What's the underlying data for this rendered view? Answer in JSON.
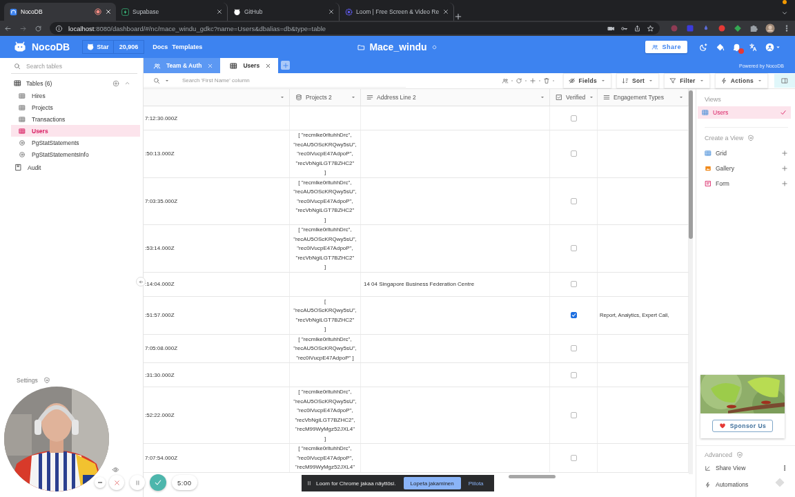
{
  "browser": {
    "tabs": [
      {
        "title": "NocoDB",
        "kind": "nocodb",
        "selected": true,
        "recording": true
      },
      {
        "title": "Supabase",
        "kind": "supabase",
        "selected": false,
        "recording": false
      },
      {
        "title": "GitHub",
        "kind": "github",
        "selected": false,
        "recording": false
      },
      {
        "title": "Loom | Free Screen & Video Re",
        "kind": "loom",
        "selected": false,
        "recording": false
      }
    ],
    "url_host": "localhost",
    "url_rest": ":8080/dashboard/#/nc/mace_windu_gdkc?name=Users&dbalias=db&type=table"
  },
  "header": {
    "brand": "NocoDB",
    "star_label": "Star",
    "star_count": "20,906",
    "links": [
      "Docs",
      "Templates"
    ],
    "project": "Mace_windu",
    "share": "Share",
    "has_notifications": true,
    "powered_by": "Powered by NocoDB"
  },
  "sidebar": {
    "search_placeholder": "Search tables",
    "group": "Tables (6)",
    "items": [
      {
        "label": "Hires",
        "kind": "table",
        "selected": false
      },
      {
        "label": "Projects",
        "kind": "table",
        "selected": false
      },
      {
        "label": "Transactions",
        "kind": "table",
        "selected": false
      },
      {
        "label": "Users",
        "kind": "table",
        "selected": true
      },
      {
        "label": "PgStatStatements",
        "kind": "view",
        "selected": false
      },
      {
        "label": "PgStatStatementsInfo",
        "kind": "view",
        "selected": false
      }
    ],
    "audit": "Audit",
    "settings": "Settings"
  },
  "tabs": [
    {
      "label": "Team & Auth",
      "kind": "team",
      "selected": false
    },
    {
      "label": "Users",
      "kind": "table",
      "selected": true
    }
  ],
  "toolbar": {
    "search_placeholder": "Search 'First Name' column",
    "menus": [
      {
        "label": "Fields",
        "kind": "fields"
      },
      {
        "label": "Sort",
        "kind": "sort"
      },
      {
        "label": "Filter",
        "kind": "filter"
      },
      {
        "label": "Actions",
        "kind": "actions"
      }
    ]
  },
  "table": {
    "columns": [
      {
        "title": "Projects 2",
        "kind": "links"
      },
      {
        "title": "Address Line 2",
        "kind": "text"
      },
      {
        "title": "Verified",
        "kind": "checkbox"
      },
      {
        "title": "Engagement Types",
        "kind": "multiselect"
      }
    ],
    "rows": [
      {
        "column_1": "7:12:30.000Z",
        "verified": false
      },
      {
        "column_1": ":50:13.000Z",
        "projects": [
          "[ \"recmlke0rltuhhDrc\",",
          "\"recAU5OScKRQwy5sU\",",
          "\"rec0iVucpE47AdpoP\",",
          "\"recVbNgiLGT7BZHC2\"",
          "]"
        ],
        "verified": false
      },
      {
        "column_1": "7:03:35.000Z",
        "projects": [
          "[ \"recmlke0rltuhhDrc\",",
          "\"recAU5OScKRQwy5sU\",",
          "\"rec0iVucpE47AdpoP\",",
          "\"recVbNgiLGT7BZHC2\"",
          "]"
        ],
        "verified": false
      },
      {
        "column_1": ":53:14.000Z",
        "projects": [
          "[ \"recmlke0rltuhhDrc\",",
          "\"recAU5OScKRQwy5sU\",",
          "\"rec0iVucpE47AdpoP\",",
          "\"recVbNgiLGT7BZHC2\"",
          "]"
        ],
        "verified": false
      },
      {
        "column_1": ":14:04.000Z",
        "address": "14 04 Singapore Business Federation Centre",
        "verified": false
      },
      {
        "column_1": ":51:57.000Z",
        "projects": [
          "[",
          "\"recAU5OScKRQwy5sU\",",
          "\"recVbNgiLGT7BZHC2\"",
          "]"
        ],
        "verified": true,
        "engagement": "Report, Analytics, Expert Call,"
      },
      {
        "column_1": "7:05:08.000Z",
        "projects": [
          "[ \"recmlke0rltuhhDrc\",",
          "\"recAU5OScKRQwy5sU\",",
          "\"rec0iVucpE47AdpoP\" ]"
        ],
        "verified": false
      },
      {
        "column_1": ":31:30.000Z",
        "verified": false
      },
      {
        "column_1": ":52:22.000Z",
        "projects": [
          "[ \"recmlke0rltuhhDrc\",",
          "\"recAU5OScKRQwy5sU\",",
          "\"rec0iVucpE47AdpoP\",",
          "\"recVbNgiLGT7BZHC2\",",
          "\"recM99WyMgz52JXL4\"",
          "]"
        ],
        "verified": false
      },
      {
        "column_1": "7:07:54.000Z",
        "projects": [
          "[ \"recmlke0rltuhhDrc\",",
          "\"rec0iVucpE47AdpoP\",",
          "\"recM99WyMgz52JXL4\""
        ],
        "verified": false
      }
    ]
  },
  "views": {
    "title": "Views",
    "items": [
      {
        "label": "Users",
        "kind": "grid",
        "selected": true
      }
    ],
    "create_title": "Create a View",
    "create": [
      {
        "label": "Grid",
        "kind": "grid"
      },
      {
        "label": "Gallery",
        "kind": "gallery"
      },
      {
        "label": "Form",
        "kind": "form"
      }
    ],
    "sponsor": "Sponsor Us",
    "advanced_title": "Advanced",
    "advanced": [
      {
        "label": "Share View",
        "kind": "share"
      },
      {
        "label": "Automations",
        "kind": "automations"
      }
    ]
  },
  "loom": {
    "timer": "5:00",
    "message": "Loom for Chrome jakaa näyttösi.",
    "stop": "Lopeta jakaminen",
    "hide": "Piilota"
  }
}
